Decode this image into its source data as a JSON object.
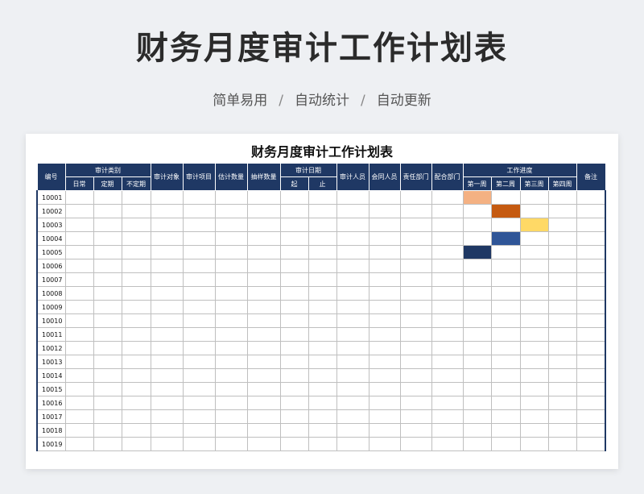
{
  "header": {
    "title": "财务月度审计工作计划表",
    "features": [
      "简单易用",
      "自动统计",
      "自动更新"
    ],
    "separator": "/"
  },
  "sheet": {
    "title": "财务月度审计工作计划表",
    "columns": {
      "id": "编号",
      "category": {
        "label": "审计类别",
        "sub": [
          "日常",
          "定期",
          "不定期"
        ]
      },
      "target": "审计对象",
      "item": "审计项目",
      "estimate": "估计数量",
      "sample": "抽样数量",
      "date": {
        "label": "审计日期",
        "sub": [
          "起",
          "止"
        ]
      },
      "auditor": "审计人员",
      "accountant": "会同人员",
      "resp_dept": "责任部门",
      "coop_dept": "配合部门",
      "progress": {
        "label": "工作进度",
        "sub": [
          "第一周",
          "第二周",
          "第三周",
          "第四周"
        ]
      },
      "note": "备注"
    },
    "rows": [
      "10001",
      "10002",
      "10003",
      "10004",
      "10005",
      "10006",
      "10007",
      "10008",
      "10009",
      "10010",
      "10011",
      "10012",
      "10013",
      "10014",
      "10015",
      "10016",
      "10017",
      "10018",
      "10019"
    ],
    "progress_fills": [
      {
        "row": 0,
        "week": 0,
        "color": "#f4b183"
      },
      {
        "row": 1,
        "week": 1,
        "color": "#c55a11"
      },
      {
        "row": 2,
        "week": 2,
        "color": "#ffd966"
      },
      {
        "row": 3,
        "week": 1,
        "color": "#2f5597"
      },
      {
        "row": 4,
        "week": 0,
        "color": "#1f3864"
      }
    ]
  }
}
